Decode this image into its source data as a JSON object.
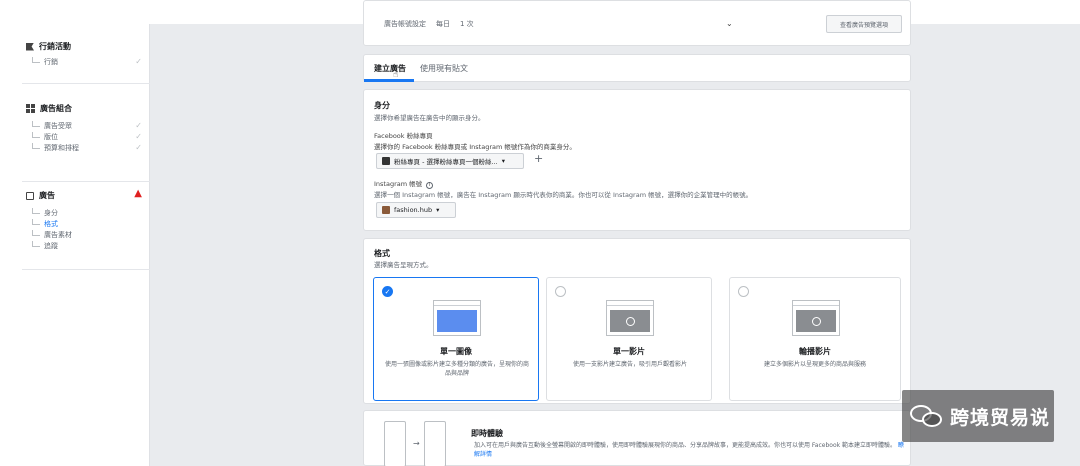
{
  "sidebar": {
    "campaign": {
      "label": "行銷活動",
      "items": [
        {
          "label": "行銷"
        }
      ]
    },
    "adset": {
      "label": "廣告組合",
      "items": [
        {
          "label": "廣告受眾"
        },
        {
          "label": "版位"
        },
        {
          "label": "預算和排程"
        }
      ]
    },
    "ad": {
      "label": "廣告",
      "warning": "▲",
      "items": [
        {
          "label": "身分"
        },
        {
          "label": "格式"
        },
        {
          "label": "廣告素材"
        },
        {
          "label": "追蹤"
        }
      ]
    },
    "check_icon": "✓"
  },
  "top_bar": {
    "selector_label": "廣告帳號設定",
    "selector_value": "每日",
    "selector_value2": "1 次",
    "chevron": "⌄",
    "button_label": "查看廣告預覽選項"
  },
  "tabs": [
    {
      "label": "建立廣告"
    },
    {
      "label": "使用現有貼文"
    }
  ],
  "identity": {
    "title": "身分",
    "subtitle": "選擇你希望廣告在廣告中的顯示身分。",
    "fb_label": "Facebook 粉絲專頁",
    "fb_desc": "選擇你的 Facebook 粉絲專頁或 Instagram 帳號作為你的商業身分。",
    "fb_page": "粉絲專頁 - 選擇粉絲專頁一個粉絲...",
    "fb_chevron": "▾",
    "plus": "+",
    "ig_label": "Instagram 帳號",
    "info": "i",
    "ig_desc": "選擇一個 Instagram 帳號，廣告在 Instagram 顯示時代表你的商業。你也可以從 Instagram 帳號，選擇你的企業管理中的帳號。",
    "ig_account": "fashion.hub",
    "ig_chevron": "▾"
  },
  "format": {
    "title": "格式",
    "subtitle": "選擇廣告呈現方式。",
    "options": [
      {
        "title": "單一圖像",
        "desc": "使用一張圖像或影片建立多種分類的廣告，呈現你的商品與品牌",
        "selected": true,
        "check": "✓"
      },
      {
        "title": "單一影片",
        "desc": "使用一支影片建立廣告，吸引用戶觀看影片",
        "selected": false,
        "check": ""
      },
      {
        "title": "輪播影片",
        "desc": "建立多個影片以呈現更多的商品與服務",
        "selected": false,
        "check": ""
      }
    ],
    "bottom_title": "即時體驗",
    "bottom_desc": "加入可在用戶與廣告互動後全螢幕開啟的即時體驗，使用即時體驗展現你的商品、分享品牌故事，更能提高成效。你也可以使用 Facebook 範本建立即時體驗。",
    "bottom_link": "瞭解詳情",
    "bottom_arrow": "→"
  },
  "watermark": {
    "text": "跨境贸易说"
  },
  "colors": {
    "accent": "#1877f2",
    "warning": "#e02020"
  }
}
